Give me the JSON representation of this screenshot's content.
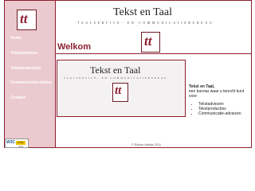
{
  "brand": {
    "name": "Tekst en Taal",
    "tagline": "TAALSERVICE- EN COMMUNICATIEBUREAU",
    "monogram": "tt"
  },
  "nav": {
    "items": [
      {
        "label": "Home"
      },
      {
        "label": "Tekstadviezen"
      },
      {
        "label": "Tekstproducties"
      },
      {
        "label": "Communicatie-advies"
      },
      {
        "label": "Contact"
      }
    ]
  },
  "main": {
    "heading": "Welkom",
    "intro": {
      "title": "Tekst en Taal,",
      "text": "een bureau waar u terecht kunt voor:",
      "services": [
        "Tekstadviezen",
        "Tekstproducties",
        "Communicatie-adviezen"
      ]
    }
  },
  "footer": {
    "copyright": "© Bloom Media 2011"
  },
  "badge": {
    "w3c": "W3C",
    "html": "HTML 4.01"
  },
  "colors": {
    "accent": "#8e1f2f",
    "sidebar": "#eac9cf"
  }
}
